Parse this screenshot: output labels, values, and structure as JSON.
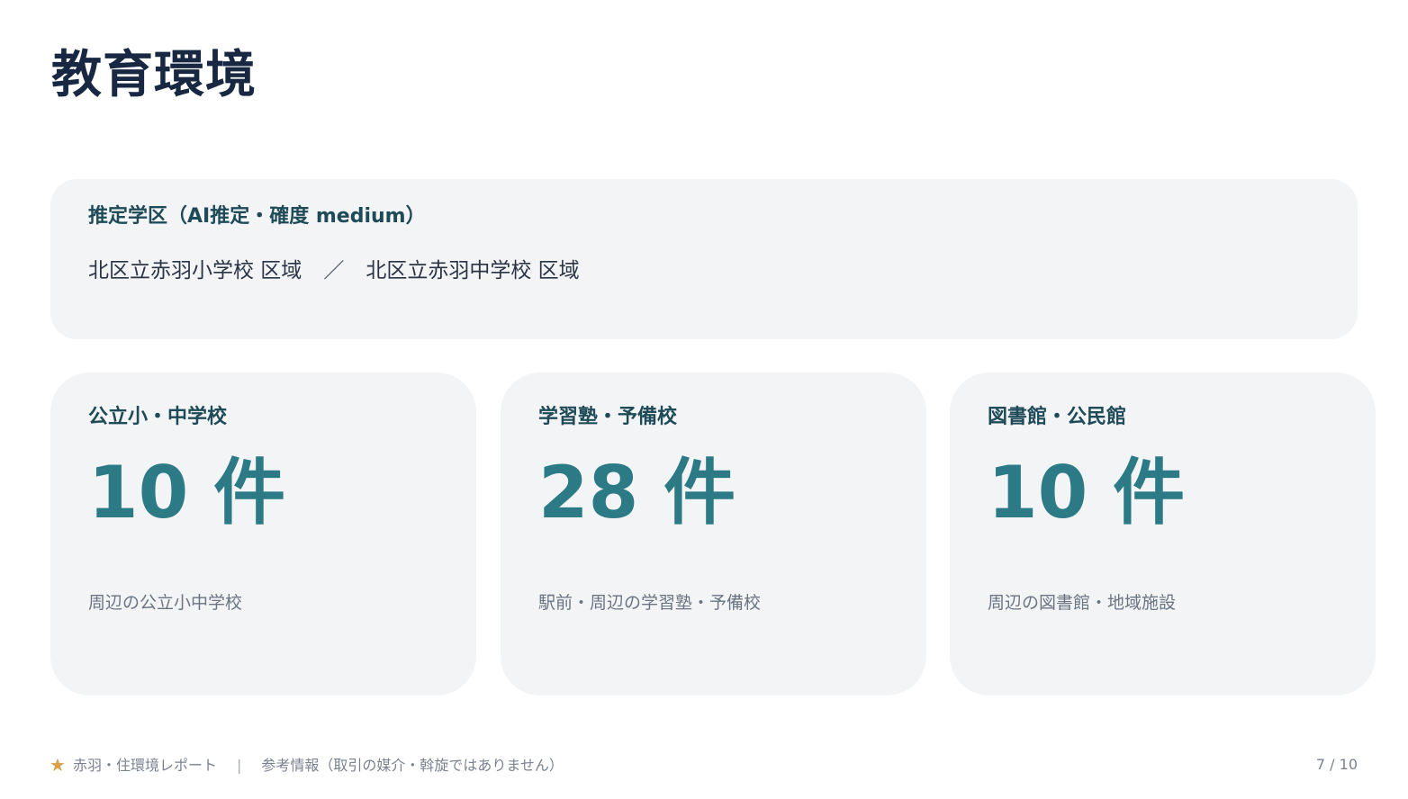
{
  "page": {
    "title": "教育環境"
  },
  "district": {
    "heading": "推定学区（AI推定・確度 medium）",
    "elementary": "北区立赤羽小学校 区域",
    "separator": "／",
    "junior_high": "北区立赤羽中学校 区域"
  },
  "stats": [
    {
      "label": "公立小・中学校",
      "value": "10 件",
      "note": "周辺の公立小中学校"
    },
    {
      "label": "学習塾・予備校",
      "value": "28 件",
      "note": "駅前・周辺の学習塾・予備校"
    },
    {
      "label": "図書館・公民館",
      "value": "10 件",
      "note": "周辺の図書館・地域施設"
    }
  ],
  "footer": {
    "star_icon": "star-icon",
    "report_name": "赤羽・住環境レポート",
    "divider": "|",
    "disclaimer": "参考情報（取引の媒介・斡旋ではありません）",
    "page_number": "7 / 10"
  },
  "colors": {
    "accent": "#2b7a86",
    "star": "#d8a24a",
    "title": "#182843"
  }
}
